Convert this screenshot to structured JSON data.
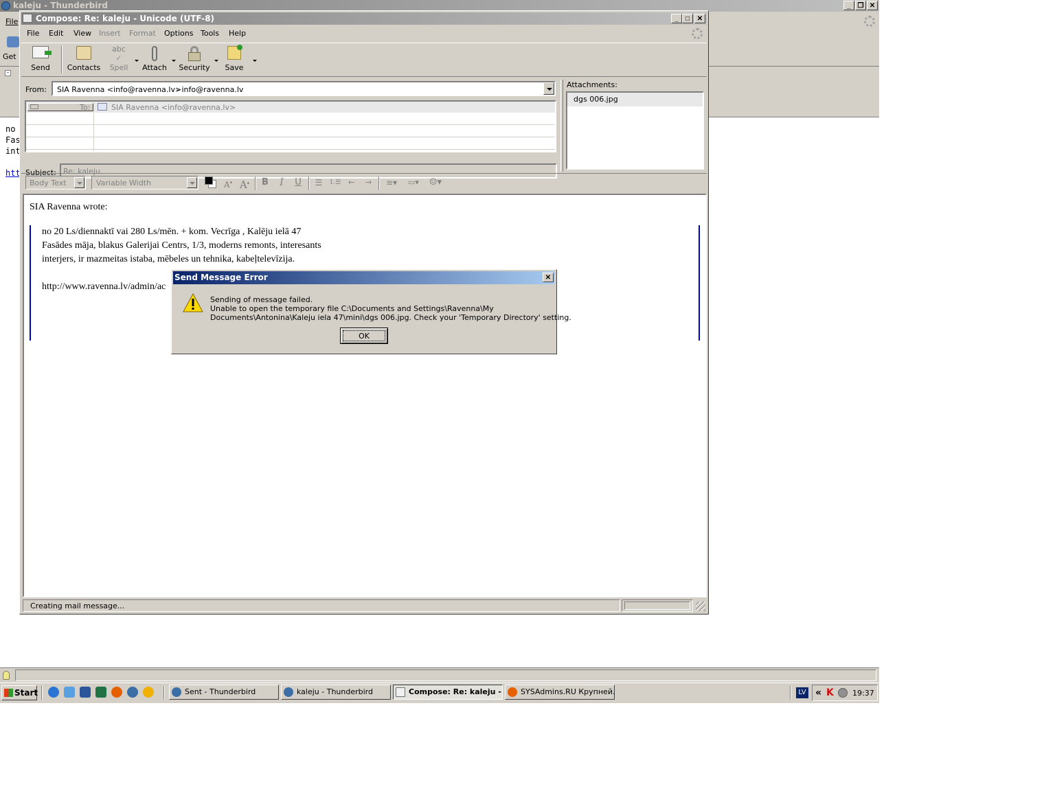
{
  "bg_window": {
    "title": "kaleju - Thunderbird",
    "menu_file": "File",
    "get_label": "Get M",
    "text_lines": [
      "no",
      "Fas",
      "int",
      "",
      "htt"
    ]
  },
  "compose": {
    "title": "Compose: Re: kaleju - Unicode (UTF-8)",
    "menu": [
      {
        "label": "File",
        "enabled": true
      },
      {
        "label": "Edit",
        "enabled": true
      },
      {
        "label": "View",
        "enabled": true
      },
      {
        "label": "Insert",
        "enabled": false
      },
      {
        "label": "Format",
        "enabled": false
      },
      {
        "label": "Options",
        "enabled": true
      },
      {
        "label": "Tools",
        "enabled": true
      },
      {
        "label": "Help",
        "enabled": true
      }
    ],
    "toolbar": {
      "send": "Send",
      "contacts": "Contacts",
      "spell": "Spell",
      "attach": "Attach",
      "security": "Security",
      "save": "Save"
    },
    "from_label": "From:",
    "from_value": "SIA Ravenna <info@ravenna.lv>",
    "from_account": "- info@ravenna.lv",
    "to_label": "To:",
    "to_value": "SIA Ravenna <info@ravenna.lv>",
    "subject_label": "Subject:",
    "subject_value": "Re: kaleju",
    "attachments_label": "Attachments:",
    "attachments": [
      "dgs 006.jpg"
    ],
    "format_bar": {
      "paragraph_style": "Body Text",
      "font": "Variable Width",
      "bold": "B",
      "italic": "I",
      "underline": "U"
    },
    "body": {
      "intro": "SIA Ravenna wrote:",
      "quote_lines": [
        "no 20 Ls/diennaktī vai 280 Ls/mēn. + kom. Vecrīga , Kalēju ielā 47",
        "Fasādes māja, blakus Galerijai Centrs, 1/3, moderns remonts, interesants",
        "interjers, ir mazmeitas istaba, mēbeles un tehnika, kabeļtelevīzija.",
        "",
        "http://www.ravenna.lv/admin/ac"
      ]
    },
    "status_text": "Creating mail message..."
  },
  "dialog": {
    "title": "Send Message Error",
    "line1": "Sending of message failed.",
    "line2": "Unable to open the temporary file C:\\Documents and Settings\\Ravenna\\My",
    "line3": "Documents\\Antonina\\Kaleju iela 47\\mini\\dgs 006.jpg. Check your 'Temporary Directory' setting.",
    "ok_label": "OK"
  },
  "taskbar": {
    "start_label": "Start",
    "buttons": [
      {
        "label": "Sent - Thunderbird",
        "active": false
      },
      {
        "label": "kaleju - Thunderbird",
        "active": false
      },
      {
        "label": "Compose: Re: kaleju -...",
        "active": true
      },
      {
        "label": "SYSAdmins.RU Крупней...",
        "active": false
      }
    ],
    "lang": "LV",
    "chevron": "«",
    "clock": "19:37"
  }
}
